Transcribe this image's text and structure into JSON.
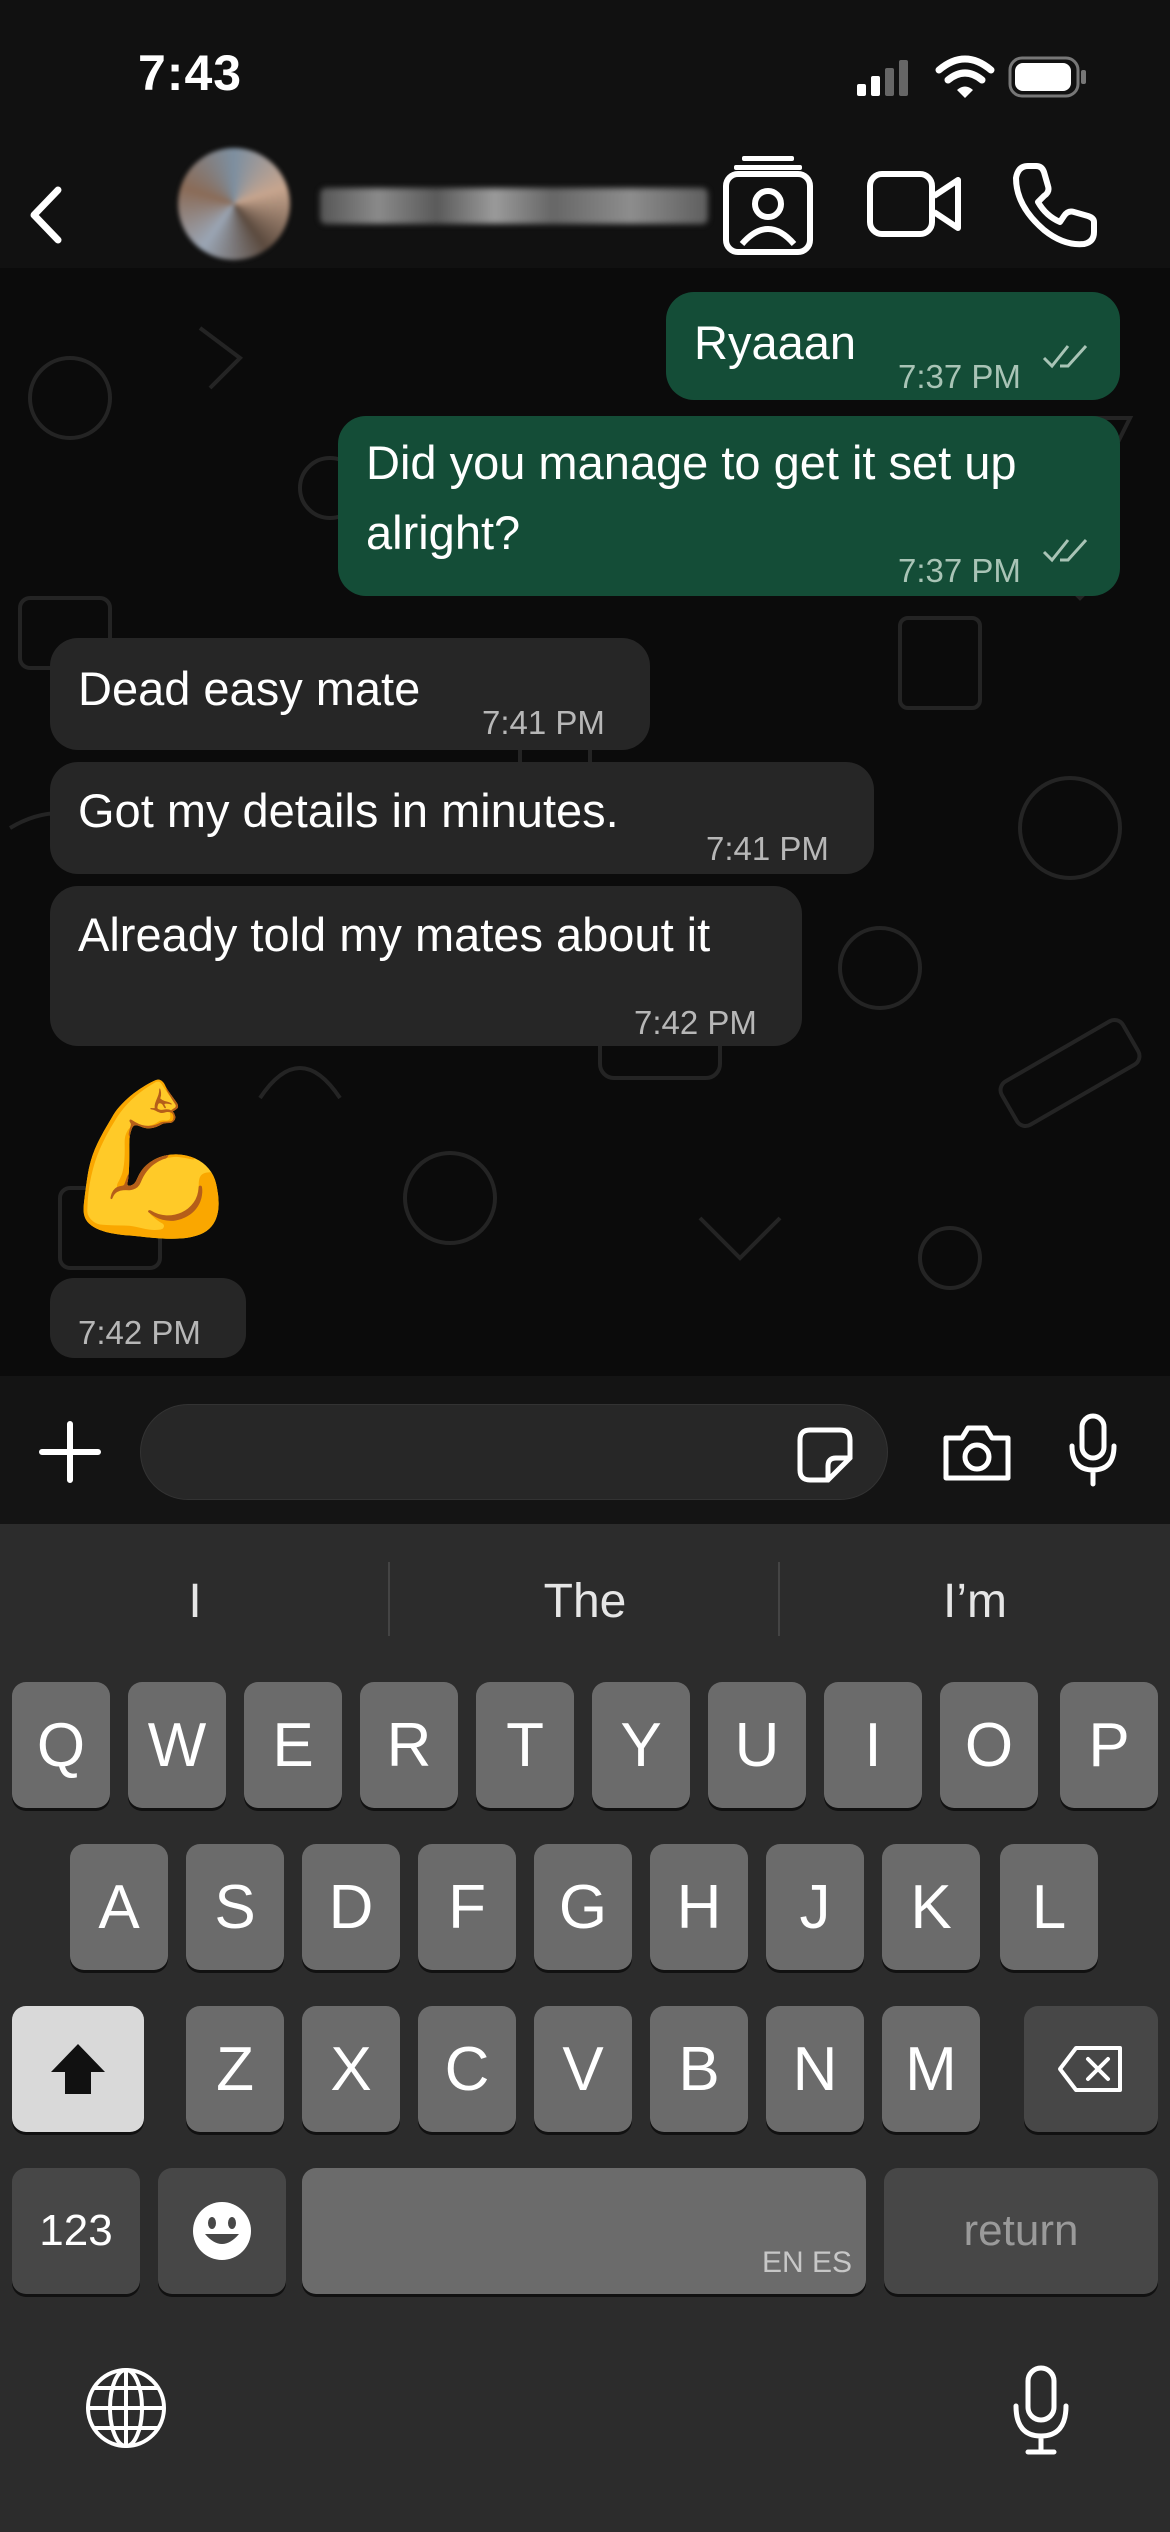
{
  "status_bar": {
    "time": "7:43"
  },
  "header": {
    "contact_name": "",
    "icons": [
      "back-icon",
      "contact-card-icon",
      "video-call-icon",
      "phone-icon"
    ]
  },
  "messages": [
    {
      "direction": "out",
      "text": "Ryaaan",
      "time": "7:37 PM",
      "status": "read"
    },
    {
      "direction": "out",
      "text_lines": [
        "Did you manage to get it set up",
        "alright?"
      ],
      "time": "7:37 PM",
      "status": "read"
    },
    {
      "direction": "in",
      "text": "Dead easy mate",
      "time": "7:41 PM"
    },
    {
      "direction": "in",
      "text": "Got my details in minutes.",
      "time": "7:41 PM"
    },
    {
      "direction": "in",
      "text": "Already told my mates about it",
      "time": "7:42 PM"
    },
    {
      "direction": "in",
      "emoji": "💪",
      "time": "7:42 PM"
    }
  ],
  "input": {
    "placeholder": ""
  },
  "keyboard": {
    "suggestions": [
      "I",
      "The",
      "I’m"
    ],
    "row1": [
      "Q",
      "W",
      "E",
      "R",
      "T",
      "Y",
      "U",
      "I",
      "O",
      "P"
    ],
    "row2": [
      "A",
      "S",
      "D",
      "F",
      "G",
      "H",
      "J",
      "K",
      "L"
    ],
    "row3": [
      "Z",
      "X",
      "C",
      "V",
      "B",
      "N",
      "M"
    ],
    "numbers_label": "123",
    "space_lang": "EN ES",
    "return_label": "return"
  },
  "colors": {
    "outgoing": "#144d37",
    "incoming": "#262626",
    "keyboard": "#2c2c2c"
  }
}
